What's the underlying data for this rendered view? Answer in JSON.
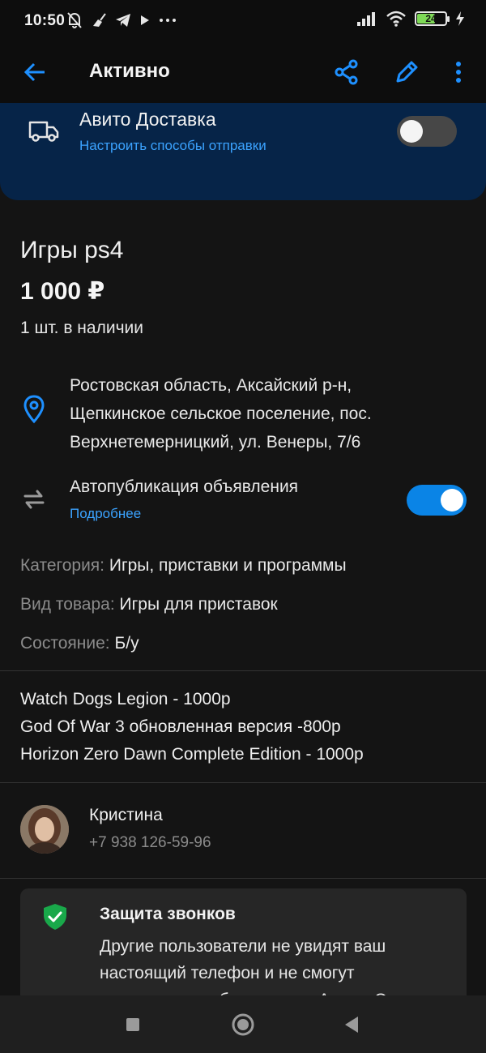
{
  "status_bar": {
    "time": "10:50",
    "battery": "24",
    "icons_left": [
      "muted-bell-icon",
      "broom-icon",
      "telegram-icon",
      "play-icon",
      "more-dots-icon"
    ],
    "icons_right": [
      "signal-icon",
      "wifi-icon",
      "battery-icon",
      "charging-icon"
    ]
  },
  "app_bar": {
    "title": "Активно",
    "icons": [
      "back-arrow-icon",
      "share-icon",
      "edit-pencil-icon",
      "more-vertical-icon"
    ],
    "accent": "#0a84e6"
  },
  "delivery": {
    "title": "Авито Доставка",
    "link": "Настроить способы отправки",
    "enabled": false,
    "background": "#062448"
  },
  "listing": {
    "title": "Игры ps4",
    "price": "1 000 ₽",
    "stock": "1 шт. в наличии",
    "address_lines": [
      "Ростовская область, Аксайский р-н,",
      "Щепкинское сельское поселение, пос.",
      "Верхнетемерницкий, ул. Венеры, 7/6"
    ]
  },
  "autopublish": {
    "label": "Автопубликация объявления",
    "link": "Подробнее",
    "enabled": true
  },
  "properties": [
    {
      "key": "Категория:",
      "value": "Игры, приставки и программы"
    },
    {
      "key": "Вид товара:",
      "value": "Игры для приставок"
    },
    {
      "key": "Состояние:",
      "value": "Б/у"
    }
  ],
  "description_lines": [
    "Watch Dogs Legion - 1000р",
    "God Of War 3 обновленная версия -800р",
    "Horizon Zero Dawn Complete Edition - 1000р"
  ],
  "seller": {
    "name": "Кристина",
    "phone": "+7 938 126-59-96"
  },
  "call_protection": {
    "title": "Защита звонков",
    "text_lines": [
      "Другие пользователи не увидят ваш",
      "настоящий телефон и не смогут",
      "позвонить вам без помощи Авито. Это"
    ],
    "icon_color": "#19a84a"
  },
  "nav_bar": {
    "icons": [
      "recents-square-icon",
      "home-circle-icon",
      "back-triangle-icon"
    ]
  }
}
